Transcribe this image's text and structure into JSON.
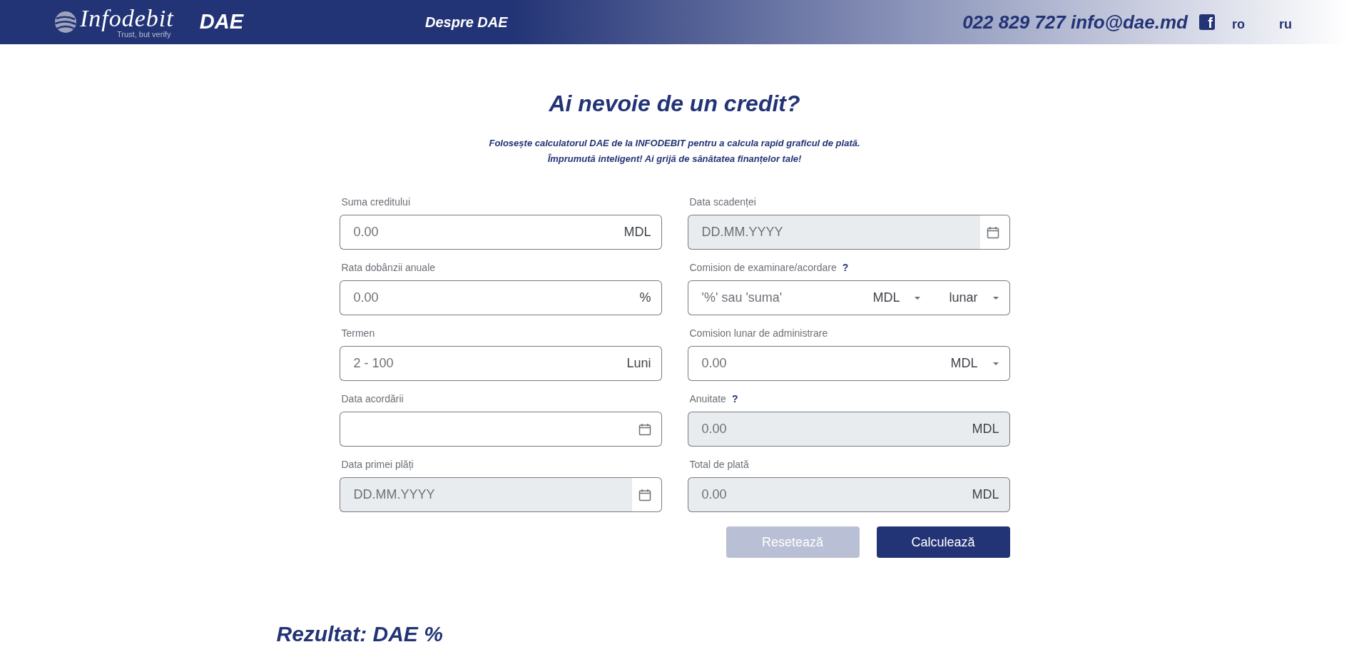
{
  "header": {
    "logo": {
      "name": "Infodebit",
      "tagline": "Trust, but verify"
    },
    "brand": "DAE",
    "nav": [
      "Despre DAE"
    ],
    "contact": "022 829 727 info@dae.md",
    "social_icon": "f",
    "languages": [
      "ro",
      "ru"
    ]
  },
  "intro": {
    "title": "Ai nevoie de un credit?",
    "lines": [
      "Folosește calculatorul DAE de la INFODEBIT pentru a calcula rapid graficul de plată.",
      "Împrumută inteligent! Ai grijă de sănătatea finanțelor tale!"
    ]
  },
  "form": {
    "columns": [
      [
        {
          "label": "Suma creditului",
          "disabled": false,
          "placeholder": "0.00",
          "addons": [
            {
              "kind": "unit",
              "text": "MDL"
            }
          ]
        },
        {
          "label": "Rata dobânzii anuale",
          "disabled": false,
          "placeholder": "0.00",
          "addons": [
            {
              "kind": "unit",
              "text": "%"
            }
          ]
        },
        {
          "label": "Termen",
          "disabled": false,
          "placeholder": "2 - 100",
          "addons": [
            {
              "kind": "unit",
              "text": "Luni"
            }
          ]
        },
        {
          "label": "Data acordării",
          "disabled": false,
          "addons": [
            {
              "kind": "calendar"
            }
          ]
        },
        {
          "label": "Data primei plăți",
          "disabled": true,
          "placeholder": "DD.MM.YYYY",
          "addons": [
            {
              "kind": "calendar"
            }
          ]
        }
      ],
      [
        {
          "label": "Data scadenței",
          "disabled": true,
          "placeholder": "DD.MM.YYYY",
          "addons": [
            {
              "kind": "calendar"
            }
          ]
        },
        {
          "label": "Comision de examinare/acordare",
          "help": "?",
          "disabled": false,
          "placeholder": "'%' sau 'suma'",
          "addons": [
            {
              "kind": "select",
              "text": "MDL"
            },
            {
              "kind": "select",
              "text": "lunar"
            }
          ]
        },
        {
          "label": "Comision lunar de administrare",
          "disabled": false,
          "placeholder": "0.00",
          "addons": [
            {
              "kind": "select",
              "text": "MDL"
            }
          ]
        },
        {
          "label": "Anuitate",
          "help": "?",
          "disabled": true,
          "placeholder": "0.00",
          "addons": [
            {
              "kind": "unit",
              "text": "MDL"
            }
          ]
        },
        {
          "label": "Total de plată",
          "disabled": true,
          "placeholder": "0.00",
          "addons": [
            {
              "kind": "unit",
              "text": "MDL"
            }
          ]
        }
      ]
    ],
    "buttons": [
      {
        "label": "Resetează",
        "disabled": true
      },
      {
        "label": "Calculează",
        "disabled": false
      }
    ]
  },
  "result": "Rezultat: DAE %"
}
